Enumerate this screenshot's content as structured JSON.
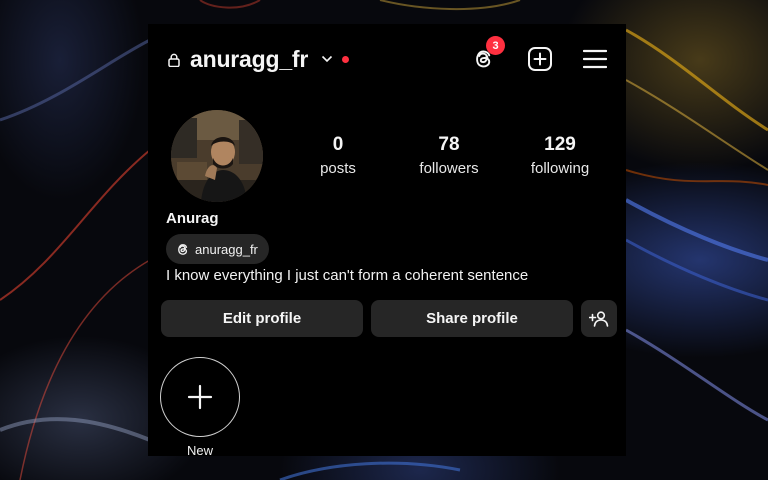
{
  "header": {
    "username": "anuragg_fr",
    "threads_badge_count": "3",
    "icons": [
      "lock-icon",
      "chevron-down-icon",
      "threads-icon",
      "create-icon",
      "menu-icon"
    ],
    "notification_dot_color": "#ff3040"
  },
  "stats": [
    {
      "value": "0",
      "label": "posts"
    },
    {
      "value": "78",
      "label": "followers"
    },
    {
      "value": "129",
      "label": "following"
    }
  ],
  "profile": {
    "display_name": "Anurag",
    "threads_handle": "anuragg_fr",
    "bio": "I know everything I just can't form a coherent sentence"
  },
  "actions": {
    "edit_profile": "Edit profile",
    "share_profile": "Share profile",
    "discover_people_icon": "add-person-icon"
  },
  "highlights": {
    "new_label": "New"
  },
  "colors": {
    "background": "#000000",
    "button": "#262626",
    "accent_red": "#ff3040",
    "text": "#f5f5f5"
  }
}
